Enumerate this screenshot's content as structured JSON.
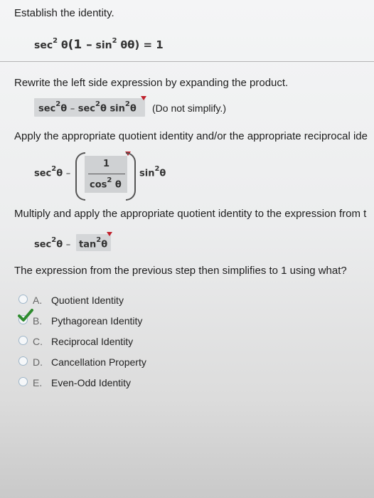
{
  "prompt": "Establish the identity.",
  "identity": {
    "sec": "sec",
    "exp": "2",
    "theta": "θ",
    "open": "(1 –",
    "sin": "sin",
    "close": "θ) = 1"
  },
  "step1": {
    "instruction": "Rewrite the left side expression by expanding the product.",
    "sec": "sec",
    "exp": "2",
    "theta": "θ",
    "minus": "–",
    "sin": "sin",
    "note": "(Do not simplify.)"
  },
  "step2": {
    "instruction": "Apply the appropriate quotient identity and/or the appropriate reciprocal ide",
    "sec": "sec",
    "exp": "2",
    "theta": "θ",
    "minus": "–",
    "numerator": "1",
    "denominator": "cos",
    "sin": "sin"
  },
  "step3": {
    "instruction": "Multiply and apply the appropriate quotient identity to the expression from t",
    "sec": "sec",
    "exp": "2",
    "theta": "θ",
    "minus": "–",
    "tan": "tan"
  },
  "question": "The expression from the previous step then simplifies to 1 using what?",
  "options": [
    {
      "letter": "A.",
      "text": "Quotient Identity",
      "selected": false
    },
    {
      "letter": "B.",
      "text": "Pythagorean Identity",
      "selected": true
    },
    {
      "letter": "C.",
      "text": "Reciprocal Identity",
      "selected": false
    },
    {
      "letter": "D.",
      "text": "Cancellation Property",
      "selected": false
    },
    {
      "letter": "E.",
      "text": "Even-Odd Identity",
      "selected": false
    }
  ],
  "colors": {
    "check": "#2e8b2e",
    "radio_border": "#9fb6c9",
    "answer_shade": "#d4d6d8",
    "marker": "#c0202b"
  }
}
